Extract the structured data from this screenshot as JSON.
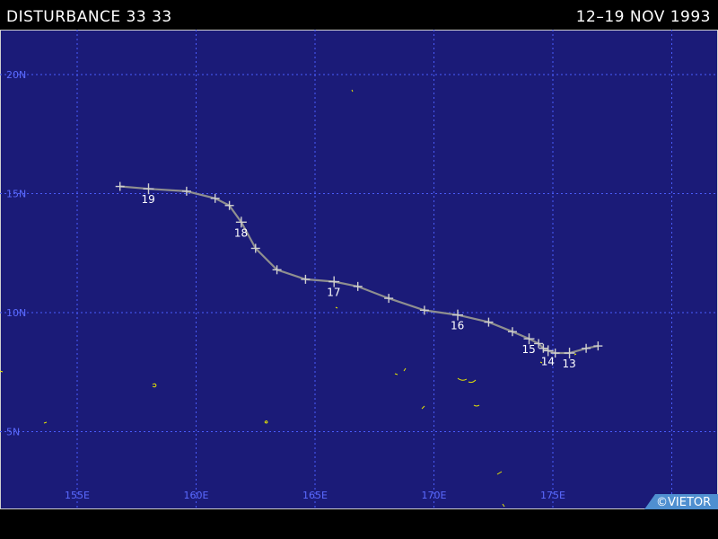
{
  "header": {
    "title": "DISTURBANCE 33 33",
    "dates": "12–19 NOV 1993"
  },
  "map": {
    "background_color": "#1b1b78",
    "grid_color": "#4a5cff",
    "track_color": "#b5b5b5",
    "coast_color": "#e8e800",
    "lat_labels": [
      "20N",
      "15N",
      "10N",
      "5N"
    ],
    "lat_values": [
      20,
      15,
      10,
      5
    ],
    "lon_labels": [
      "155E",
      "160E",
      "165E",
      "170E",
      "175E"
    ],
    "lon_values": [
      155,
      160,
      165,
      170,
      175
    ]
  },
  "track": {
    "points": [
      {
        "lon": 176.9,
        "lat": 8.6
      },
      {
        "lon": 176.4,
        "lat": 8.5
      },
      {
        "lon": 175.7,
        "lat": 8.3,
        "label": "13"
      },
      {
        "lon": 175.1,
        "lat": 8.3
      },
      {
        "lon": 174.8,
        "lat": 8.4,
        "label": "14"
      },
      {
        "lon": 174.6,
        "lat": 8.5
      },
      {
        "lon": 174.4,
        "lat": 8.7
      },
      {
        "lon": 174.0,
        "lat": 8.9,
        "label": "15"
      },
      {
        "lon": 173.3,
        "lat": 9.2
      },
      {
        "lon": 172.3,
        "lat": 9.6
      },
      {
        "lon": 171.0,
        "lat": 9.9,
        "label": "16"
      },
      {
        "lon": 169.6,
        "lat": 10.1
      },
      {
        "lon": 168.1,
        "lat": 10.6
      },
      {
        "lon": 166.8,
        "lat": 11.1
      },
      {
        "lon": 165.8,
        "lat": 11.3,
        "label": "17"
      },
      {
        "lon": 164.6,
        "lat": 11.4
      },
      {
        "lon": 163.4,
        "lat": 11.8
      },
      {
        "lon": 162.5,
        "lat": 12.7
      },
      {
        "lon": 161.9,
        "lat": 13.8,
        "label": "18"
      },
      {
        "lon": 161.4,
        "lat": 14.5
      },
      {
        "lon": 160.8,
        "lat": 14.8
      },
      {
        "lon": 159.6,
        "lat": 15.1
      },
      {
        "lon": 158.0,
        "lat": 15.2,
        "label": "19"
      },
      {
        "lon": 156.8,
        "lat": 15.3
      }
    ]
  },
  "watermark": {
    "text": "©VIETOR"
  }
}
